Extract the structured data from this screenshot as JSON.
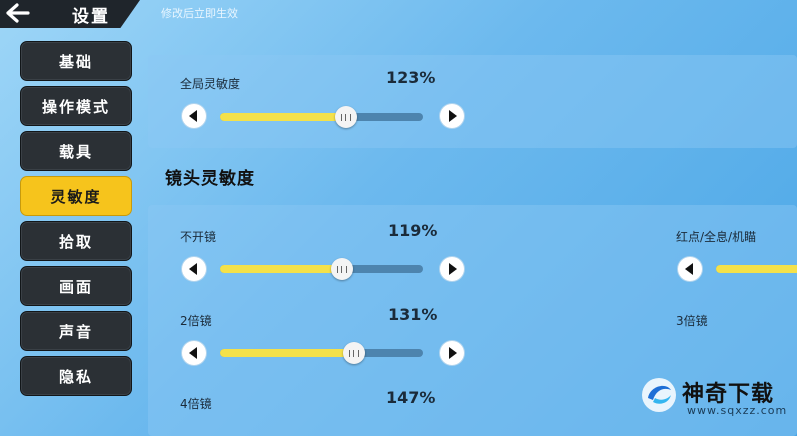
{
  "header": {
    "title": "设置",
    "notice": "修改后立即生效",
    "back_icon": "arrow-left-icon"
  },
  "sidebar": {
    "items": [
      {
        "label": "基础",
        "active": false
      },
      {
        "label": "操作模式",
        "active": false
      },
      {
        "label": "载具",
        "active": false
      },
      {
        "label": "灵敏度",
        "active": true
      },
      {
        "label": "拾取",
        "active": false
      },
      {
        "label": "画面",
        "active": false
      },
      {
        "label": "声音",
        "active": false
      },
      {
        "label": "隐私",
        "active": false
      }
    ],
    "active_color": "#f6c41c",
    "inactive_color": "#2b3035"
  },
  "global": {
    "label": "全局灵敏度",
    "value_text": "123%",
    "fraction": 0.62
  },
  "camera": {
    "section_title": "镜头灵敏度",
    "sliders": [
      {
        "label": "不开镜",
        "value_text": "119%",
        "fraction": 0.6
      },
      {
        "label": "2倍镜",
        "value_text": "131%",
        "fraction": 0.66
      },
      {
        "label": "4倍镜",
        "value_text": "147%"
      }
    ],
    "right_column": [
      {
        "label": "红点/全息/机瞄"
      },
      {
        "label": "3倍镜"
      }
    ]
  },
  "watermark": {
    "name": "神奇下载",
    "url": "www.sqxzz.com"
  },
  "colors": {
    "fill": "#f4e14a",
    "track": "#4d84ae",
    "background": "#6cb9ee"
  }
}
